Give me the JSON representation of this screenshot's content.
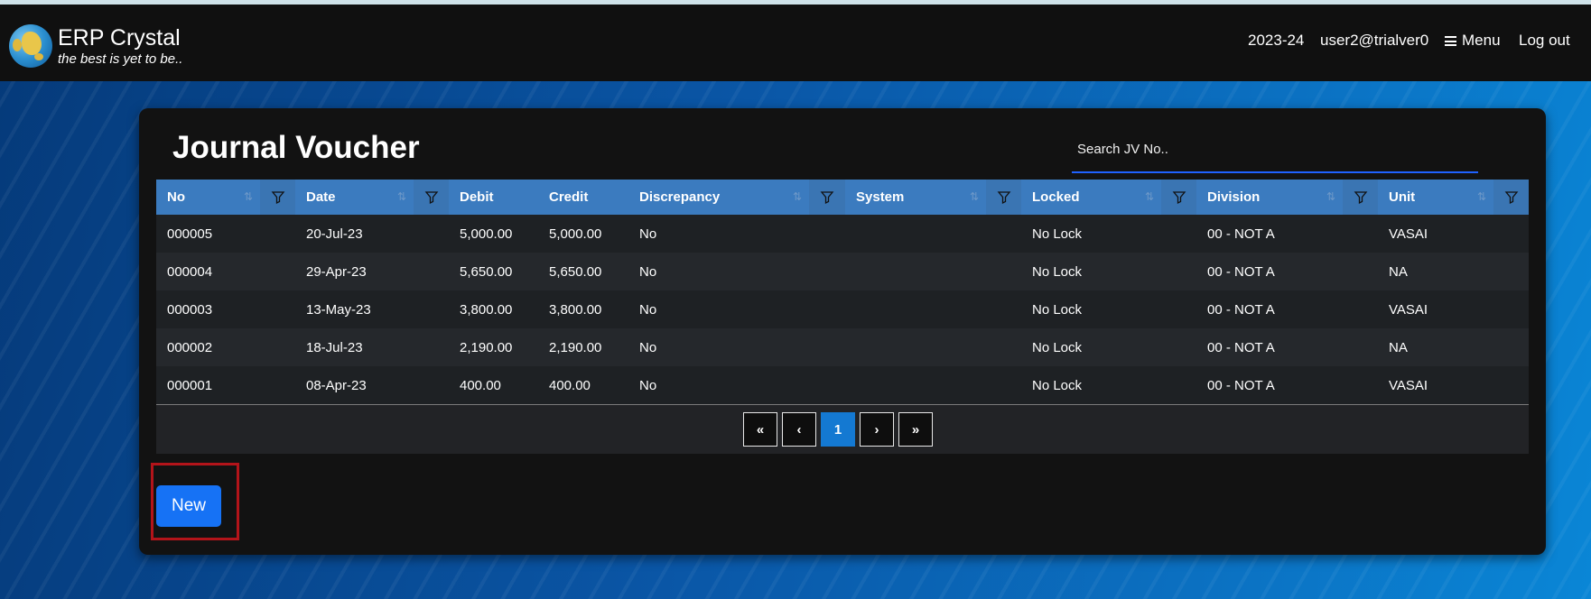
{
  "app": {
    "brand": "ERP Crystal",
    "tagline": "the best is yet to be..",
    "logo_icon": "globe-icon"
  },
  "header": {
    "year": "2023-24",
    "user": "user2@trialver0",
    "menu_label": "Menu",
    "logout_label": "Log out"
  },
  "page": {
    "title": "Journal Voucher",
    "search_placeholder": "Search JV No.."
  },
  "table": {
    "columns": [
      "No",
      "Date",
      "Debit",
      "Credit",
      "Discrepancy",
      "System",
      "Locked",
      "Division",
      "Unit"
    ],
    "rows": [
      {
        "no": "000005",
        "date": "20-Jul-23",
        "debit": "5,000.00",
        "credit": "5,000.00",
        "discrepancy": "No",
        "system": "",
        "locked": "No Lock",
        "division": "00 - NOT A",
        "unit": "VASAI"
      },
      {
        "no": "000004",
        "date": "29-Apr-23",
        "debit": "5,650.00",
        "credit": "5,650.00",
        "discrepancy": "No",
        "system": "",
        "locked": "No Lock",
        "division": "00 - NOT A",
        "unit": "NA"
      },
      {
        "no": "000003",
        "date": "13-May-23",
        "debit": "3,800.00",
        "credit": "3,800.00",
        "discrepancy": "No",
        "system": "",
        "locked": "No Lock",
        "division": "00 - NOT A",
        "unit": "VASAI"
      },
      {
        "no": "000002",
        "date": "18-Jul-23",
        "debit": "2,190.00",
        "credit": "2,190.00",
        "discrepancy": "No",
        "system": "",
        "locked": "No Lock",
        "division": "00 - NOT A",
        "unit": "NA"
      },
      {
        "no": "000001",
        "date": "08-Apr-23",
        "debit": "400.00",
        "credit": "400.00",
        "discrepancy": "No",
        "system": "",
        "locked": "No Lock",
        "division": "00 - NOT A",
        "unit": "VASAI"
      }
    ]
  },
  "pagination": {
    "first": "«",
    "prev": "‹",
    "current": "1",
    "next": "›",
    "last": "»"
  },
  "actions": {
    "new_label": "New"
  },
  "colors": {
    "header_bg": "#101010",
    "table_header": "#3b7bbf",
    "primary_button": "#1672f5",
    "active_page": "#1479d2",
    "highlight_box": "#b3141a"
  }
}
